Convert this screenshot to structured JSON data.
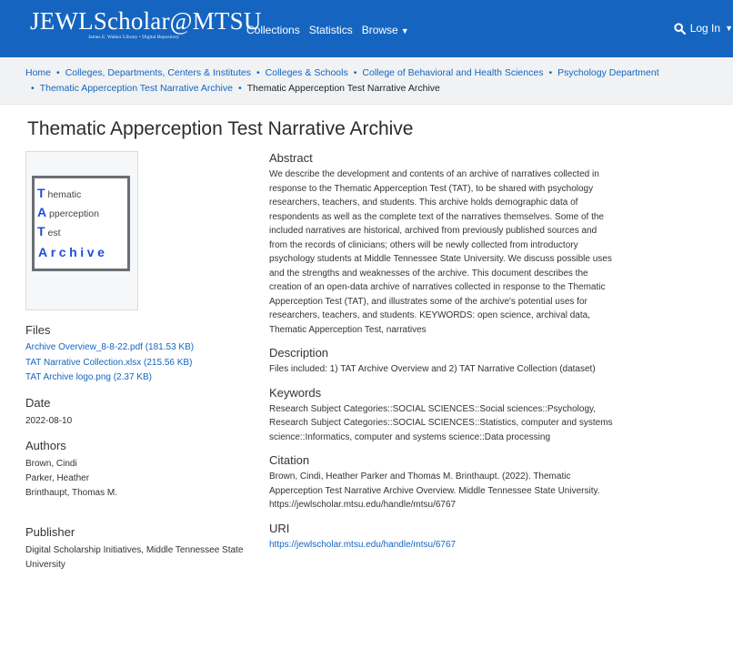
{
  "header": {
    "brand": "JEWLScholar@MTSU",
    "brand_sub": "James E. Walker Library • Digital Repository",
    "nav": [
      "Collections",
      "Statistics",
      "Browse"
    ],
    "login": "Log In"
  },
  "breadcrumb": {
    "items": [
      "Home",
      "Colleges, Departments, Centers & Institutes",
      "Colleges & Schools",
      "College of Behavioral and Health Sciences",
      "Psychology Department",
      "Thematic Apperception Test Narrative Archive"
    ],
    "current": "Thematic Apperception Test Narrative Archive"
  },
  "page": {
    "title": "Thematic Apperception Test Narrative Archive"
  },
  "logo": {
    "l1": "T",
    "w1": "hematic",
    "l2": "A",
    "w2": "pperception",
    "l3": "T",
    "w3": "est",
    "archive": "Archive"
  },
  "files": {
    "heading": "Files",
    "items": [
      "Archive Overview_8-8-22.pdf (181.53 KB)",
      "TAT Narrative Collection.xlsx (215.56 KB)",
      "TAT Archive logo.png (2.37 KB)"
    ]
  },
  "date": {
    "heading": "Date",
    "value": "2022-08-10"
  },
  "authors": {
    "heading": "Authors",
    "items": [
      "Brown, Cindi",
      "Parker, Heather",
      "Brinthaupt, Thomas M."
    ]
  },
  "publisher": {
    "heading": "Publisher",
    "value": "Digital Scholarship Initiatives, Middle Tennessee State University"
  },
  "abstract": {
    "heading": "Abstract",
    "text": "We describe the development and contents of an archive of narratives collected in response to the Thematic Apperception Test (TAT), to be shared with psychology researchers, teachers, and students. This archive holds demographic data of respondents as well as the complete text of the narratives themselves. Some of the included narratives are historical, archived from previously published sources and from the records of clinicians; others will be newly collected from introductory psychology students at Middle Tennessee State University. We discuss possible uses and the strengths and weaknesses of the archive. This document describes the creation of an open-data archive of narratives collected in response to the Thematic Apperception Test (TAT), and illustrates some of the archive's potential uses for researchers, teachers, and students. KEYWORDS: open science, archival data, Thematic Apperception Test, narratives"
  },
  "description": {
    "heading": "Description",
    "text": "Files included: 1) TAT Archive Overview and 2) TAT Narrative Collection (dataset)"
  },
  "keywords": {
    "heading": "Keywords",
    "text": "Research Subject Categories::SOCIAL SCIENCES::Social sciences::Psychology, Research Subject Categories::SOCIAL SCIENCES::Statistics, computer and systems science::Informatics, computer and systems science::Data processing"
  },
  "citation": {
    "heading": "Citation",
    "text": "Brown, Cindi, Heather Parker and Thomas M. Brinthaupt. (2022). Thematic Apperception Test Narrative Archive Overview. Middle Tennessee State University. https://jewlscholar.mtsu.edu/handle/mtsu/6767"
  },
  "uri": {
    "heading": "URI",
    "value": "https://jewlscholar.mtsu.edu/handle/mtsu/6767"
  },
  "colors": {
    "header_bg": "#1565c0",
    "link": "#1565c0",
    "breadcrumb_bg": "#f0f2f4",
    "logo_blue": "#1d4fd8"
  }
}
